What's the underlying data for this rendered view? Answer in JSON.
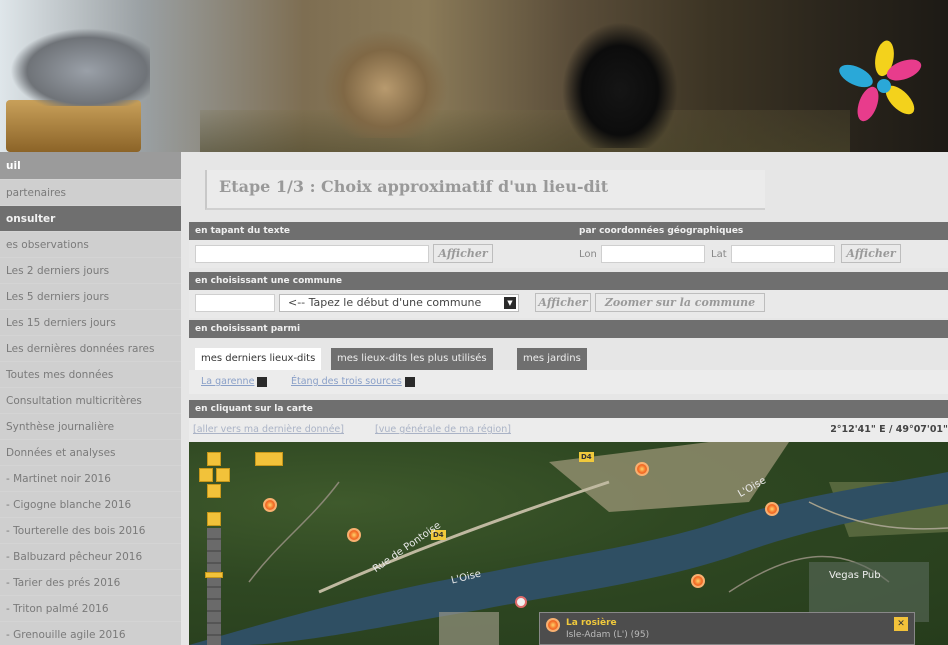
{
  "sidebar": {
    "items": [
      {
        "label": "uil",
        "style": "head"
      },
      {
        "label": "partenaires",
        "style": "plain"
      },
      {
        "label": "onsulter",
        "style": "dark"
      },
      {
        "label": "es observations",
        "style": "plain"
      },
      {
        "label": "Les 2 derniers jours",
        "style": "plain"
      },
      {
        "label": "Les 5 derniers jours",
        "style": "plain"
      },
      {
        "label": "Les 15 derniers jours",
        "style": "plain"
      },
      {
        "label": "Les dernières données rares",
        "style": "plain"
      },
      {
        "label": "Toutes mes données",
        "style": "plain"
      },
      {
        "label": "Consultation multicritères",
        "style": "plain"
      },
      {
        "label": "Synthèse journalière",
        "style": "plain"
      },
      {
        "label": "Données et analyses",
        "style": "plain"
      },
      {
        "label": "- Martinet noir 2016",
        "style": "plain"
      },
      {
        "label": "- Cigogne blanche 2016",
        "style": "plain"
      },
      {
        "label": "- Tourterelle des bois 2016",
        "style": "plain"
      },
      {
        "label": "- Balbuzard pêcheur 2016",
        "style": "plain"
      },
      {
        "label": "- Tarier des prés 2016",
        "style": "plain"
      },
      {
        "label": "- Triton palmé 2016",
        "style": "plain"
      },
      {
        "label": "- Grenouille agile 2016",
        "style": "plain"
      }
    ]
  },
  "page": {
    "title": "Etape 1/3 : Choix approximatif d'un lieu-dit"
  },
  "section_text": {
    "header": "en tapant du texte",
    "button": "Afficher"
  },
  "section_geo": {
    "header": "par coordonnées géographiques",
    "lon_label": "Lon",
    "lat_label": "Lat",
    "button": "Afficher"
  },
  "section_commune": {
    "header": "en choisissant une commune",
    "select_value": "<-- Tapez le début d'une commune",
    "button": "Afficher",
    "zoom_button": "Zoomer sur la commune"
  },
  "section_parmi": {
    "header": "en choisissant parmi",
    "tabs": [
      "mes derniers lieux-dits",
      "mes lieux-dits les plus utilisés",
      "mes jardins"
    ],
    "links": [
      "La garenne",
      "Étang des trois sources"
    ]
  },
  "section_map": {
    "header": "en cliquant sur la carte",
    "links": [
      "[aller vers ma dernière donnée]",
      "[vue générale de ma région]"
    ],
    "coords": "2°12'41\" E / 49°07'01\"",
    "labels": {
      "river1": "L'Oise",
      "river2": "L'Oise",
      "road": "Rue de Pontoise",
      "pub": "Vegas Pub",
      "tag_d4": "D4",
      "tag_d4b": "D4"
    },
    "popup": {
      "title": "La rosière",
      "subtitle": "Isle-Adam (L') (95)"
    }
  },
  "colors": {
    "bar": "#6f6f6f",
    "accent": "#f2c23a",
    "link": "#8aa0c8"
  }
}
